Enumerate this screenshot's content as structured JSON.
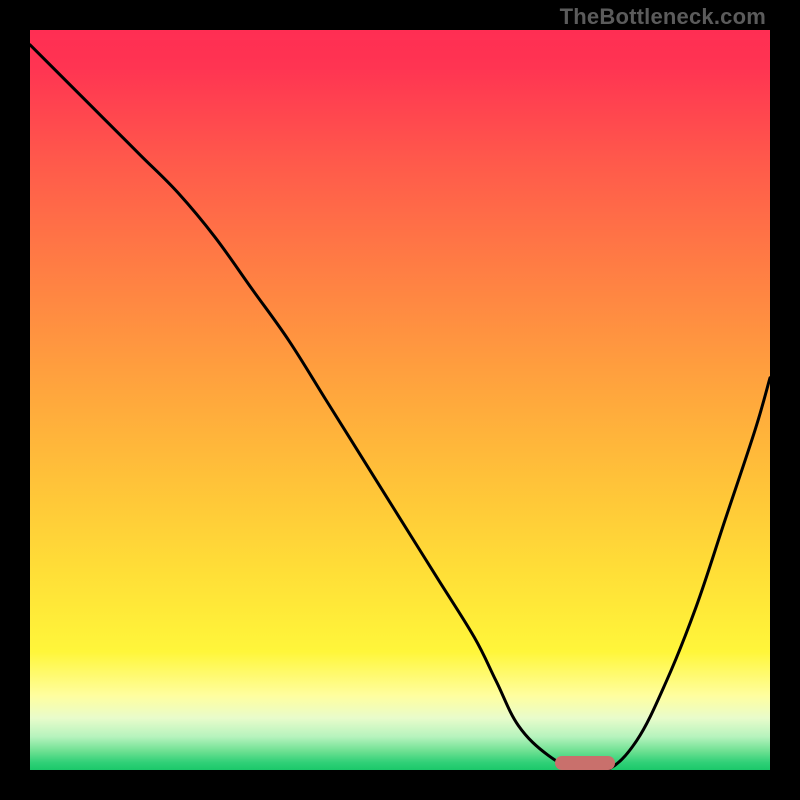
{
  "watermark": "TheBottleneck.com",
  "chart_data": {
    "type": "line",
    "title": "",
    "xlabel": "",
    "ylabel": "",
    "xlim": [
      0,
      100
    ],
    "ylim": [
      0,
      100
    ],
    "grid": false,
    "x": [
      0,
      6,
      10,
      15,
      20,
      25,
      30,
      35,
      40,
      45,
      50,
      55,
      60,
      63,
      66,
      70,
      74,
      78,
      82,
      86,
      90,
      94,
      98,
      100
    ],
    "y": [
      98,
      92,
      88,
      83,
      78,
      72,
      65,
      58,
      50,
      42,
      34,
      26,
      18,
      12,
      6,
      2,
      0,
      0,
      4,
      12,
      22,
      34,
      46,
      53
    ],
    "optimal_zone": {
      "x_start": 71,
      "x_end": 79,
      "y": 1
    },
    "gradient_stops": [
      {
        "offset": 0.0,
        "color": "#ff2e53"
      },
      {
        "offset": 0.05,
        "color": "#ff3452"
      },
      {
        "offset": 0.18,
        "color": "#ff5a4b"
      },
      {
        "offset": 0.32,
        "color": "#ff7d44"
      },
      {
        "offset": 0.46,
        "color": "#ff9f3e"
      },
      {
        "offset": 0.6,
        "color": "#ffc039"
      },
      {
        "offset": 0.73,
        "color": "#ffde37"
      },
      {
        "offset": 0.84,
        "color": "#fff63a"
      },
      {
        "offset": 0.9,
        "color": "#fffea0"
      },
      {
        "offset": 0.93,
        "color": "#e8fccb"
      },
      {
        "offset": 0.955,
        "color": "#b6f3bd"
      },
      {
        "offset": 0.975,
        "color": "#6ce091"
      },
      {
        "offset": 0.99,
        "color": "#2fd077"
      },
      {
        "offset": 1.0,
        "color": "#1bc86a"
      }
    ]
  }
}
